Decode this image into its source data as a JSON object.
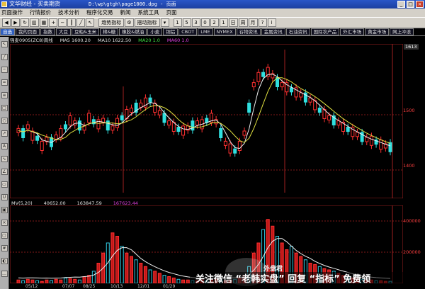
{
  "window": {
    "title": "文华财经 - 买卖期货",
    "path": "D:\\wp\\gtgh\\page1000.dpg - 页面"
  },
  "menu": [
    "页面操作",
    "行情报价",
    "技术分析",
    "程序化交易",
    "新闻",
    "系统工具",
    "页面"
  ],
  "toolbar": {
    "trend_label": "趋势指标",
    "swing_label": "摆动指标",
    "nums": [
      "1",
      "5",
      "3",
      "0",
      "2",
      "1"
    ]
  },
  "tabs": [
    "自选",
    "我的页面",
    "指数",
    "大豆",
    "豆粕&玉米",
    "棉&糖",
    "橡胶&燃油",
    "小麦",
    "铜铝",
    "CBOT",
    "LME",
    "NYMEX",
    "谷物资讯",
    "金属资讯",
    "石油资讯",
    "国际农产品",
    "外汇市场",
    "黄金市场",
    "网上冲浪"
  ],
  "info": {
    "contract": "强麦0905(ZC8)周线",
    "ma5": "MA5 1600.20",
    "ma10": "MA10 1622.50",
    "ma20": "MA20 1.0",
    "ma60": "MA60 1.0"
  },
  "volume_info": {
    "label": "MV(5,20)",
    "v1": "40652.00",
    "v2": "163847.59",
    "v3": "167623.44"
  },
  "axis": {
    "price_top": "1613",
    "price_mid": "1500",
    "price_low": "1400",
    "vol_high": "400000",
    "vol_mid": "200000"
  },
  "xlabels": [
    "05/12",
    "07/07",
    "08/25",
    "10/13",
    "12/01",
    "01/29"
  ],
  "watermark": {
    "brand": "外盘君",
    "caption": "关注微信 “老韩实盘” 回复 “指标” 免费领"
  },
  "chart_data": {
    "type": "candlestick",
    "x": [
      "05/12",
      "07/07",
      "08/25",
      "10/13",
      "12/01",
      "01/29"
    ],
    "note_series": [
      "price candles",
      "MA5",
      "MA10",
      "volume bars"
    ],
    "volume_ylim": [
      0,
      400000
    ]
  }
}
